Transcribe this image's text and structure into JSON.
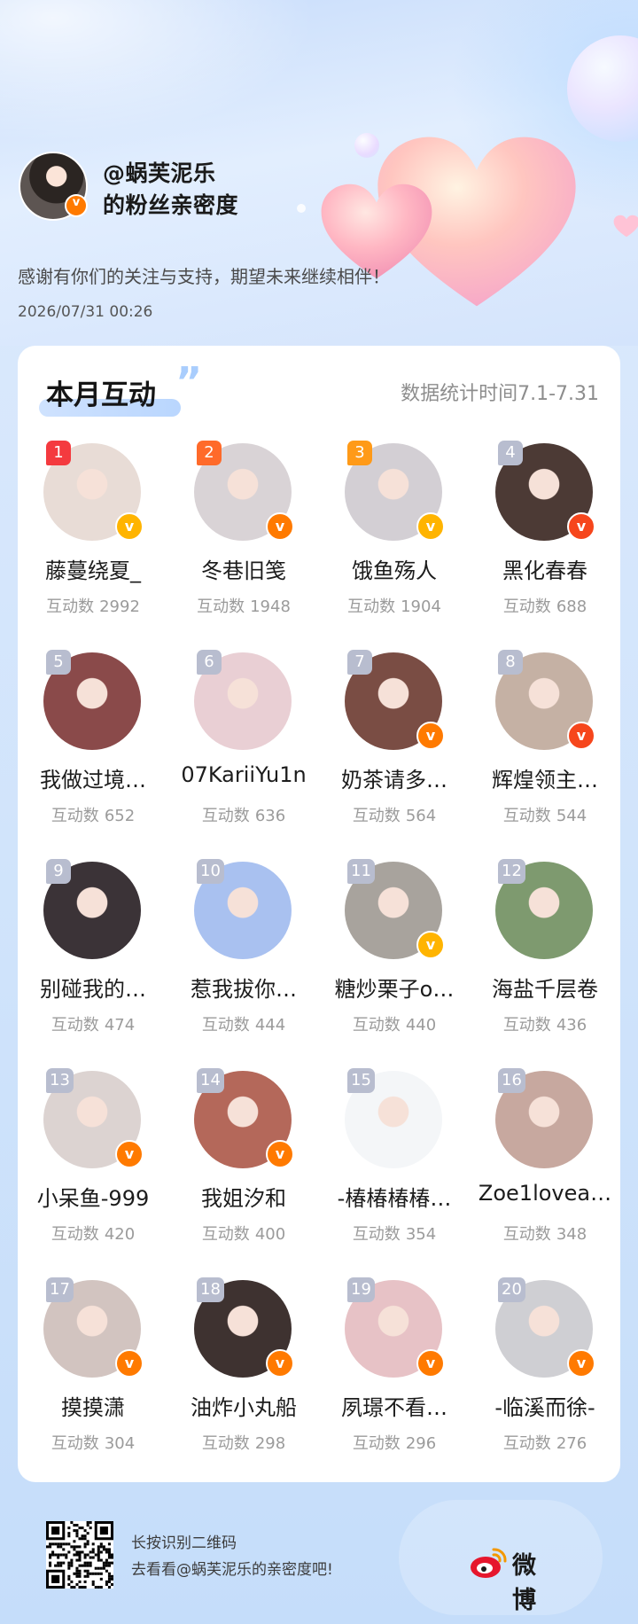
{
  "header": {
    "handle": "@蜗芙泥乐",
    "title_suffix": "的粉丝亲密度",
    "subtitle": "感谢有你们的关注与支持，期望未来继续相伴！",
    "datetime": "2026/07/31 00:26"
  },
  "card": {
    "title": "本月互动",
    "quote_mark": "”",
    "stat_period": "数据统计时间7.1-7.31",
    "count_label": "互动数",
    "fans": [
      {
        "rank": "1",
        "name": "藤蔓绕夏_",
        "count": "2992",
        "badge": "yellow",
        "avatar_color": "#e8dcd6"
      },
      {
        "rank": "2",
        "name": "冬巷旧笺",
        "count": "1948",
        "badge": "orange",
        "avatar_color": "#d9d3d6"
      },
      {
        "rank": "3",
        "name": "饿鱼殇人",
        "count": "1904",
        "badge": "yellow",
        "avatar_color": "#d3cfd4"
      },
      {
        "rank": "4",
        "name": "黑化春春",
        "count": "688",
        "badge": "red",
        "avatar_color": "#4c3a35"
      },
      {
        "rank": "5",
        "name": "我做过境…",
        "count": "652",
        "badge": "",
        "avatar_color": "#8a4a4a"
      },
      {
        "rank": "6",
        "name": "07KariiYu1n",
        "count": "636",
        "badge": "",
        "avatar_color": "#e9cfd4"
      },
      {
        "rank": "7",
        "name": "奶茶请多…",
        "count": "564",
        "badge": "orange",
        "avatar_color": "#7a4d44"
      },
      {
        "rank": "8",
        "name": "辉煌领主…",
        "count": "544",
        "badge": "red",
        "avatar_color": "#c5b1a4"
      },
      {
        "rank": "9",
        "name": "别碰我的…",
        "count": "474",
        "badge": "",
        "avatar_color": "#3b3337"
      },
      {
        "rank": "10",
        "name": "惹我拔你…",
        "count": "444",
        "badge": "",
        "avatar_color": "#a9c1f0"
      },
      {
        "rank": "11",
        "name": "糖炒栗子o…",
        "count": "440",
        "badge": "yellow",
        "avatar_color": "#a8a39d"
      },
      {
        "rank": "12",
        "name": "海盐千层卷",
        "count": "436",
        "badge": "",
        "avatar_color": "#7e9a6f"
      },
      {
        "rank": "13",
        "name": "小呆鱼-999",
        "count": "420",
        "badge": "orange",
        "avatar_color": "#dcd3d1"
      },
      {
        "rank": "14",
        "name": "我姐汐和",
        "count": "400",
        "badge": "orange",
        "avatar_color": "#b4685a"
      },
      {
        "rank": "15",
        "name": "-椿椿椿椿…",
        "count": "354",
        "badge": "",
        "avatar_color": "#f4f6f8"
      },
      {
        "rank": "16",
        "name": "Zoe1lovea…",
        "count": "348",
        "badge": "",
        "avatar_color": "#c7a89f"
      },
      {
        "rank": "17",
        "name": "摸摸潇",
        "count": "304",
        "badge": "orange",
        "avatar_color": "#d2c4c0"
      },
      {
        "rank": "18",
        "name": "油炸小丸船",
        "count": "298",
        "badge": "orange",
        "avatar_color": "#3e3230"
      },
      {
        "rank": "19",
        "name": "夙璟不看…",
        "count": "296",
        "badge": "orange",
        "avatar_color": "#e7c2c6"
      },
      {
        "rank": "20",
        "name": "-临溪而徐-",
        "count": "276",
        "badge": "orange",
        "avatar_color": "#cfcfd3"
      }
    ]
  },
  "footer": {
    "line1": "长按识别二维码",
    "line2": "去看看@蜗芙泥乐的亲密度吧!",
    "brand": "微博"
  },
  "colors": {
    "rank_1": "#f43a3f",
    "rank_2": "#ff6a2a",
    "rank_3": "#ff9a18",
    "rank_other": "#b8bdcf",
    "badge_yellow": "#ffb400",
    "badge_orange": "#ff7a00",
    "badge_red": "#f6461c",
    "accent_blue": "#a9cdfd"
  }
}
